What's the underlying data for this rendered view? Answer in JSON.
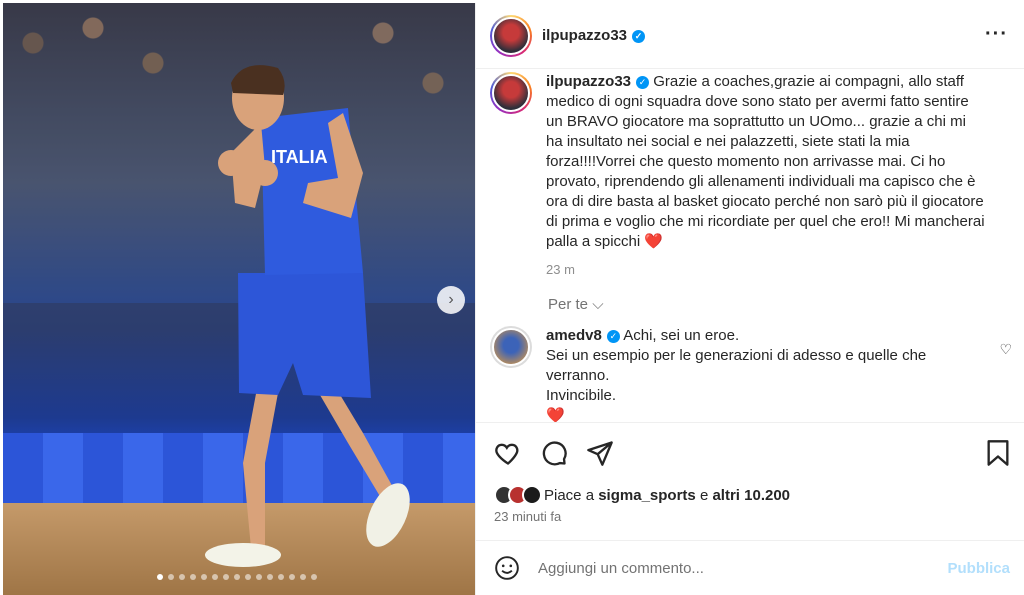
{
  "post": {
    "username": "ilpupazzo33",
    "more_icon": "more-horizontal-icon"
  },
  "caption": {
    "username": "ilpupazzo33",
    "text": "Grazie a coaches,grazie ai compagni, allo staff medico di ogni squadra dove sono stato per avermi fatto sentire un BRAVO giocatore ma soprattutto un UOmo... grazie a chi mi ha insultato nei social e nei palazzetti, siete stati la mia forza!!!!Vorrei che questo momento non arrivasse mai. Ci ho provato, riprendendo gli allenamenti individuali ma capisco che è ora di dire basta al basket giocato perché non sarò più il giocatore di prima e voglio che mi ricordiate per quel che ero!! Mi mancherai palla a spicchi",
    "heart": "❤️",
    "age": "23 m"
  },
  "per_te_label": "Per te",
  "comment": {
    "username": "amedv8",
    "line1": "Achi, sei un eroe.",
    "line2": "Sei un esempio per le generazioni di adesso e quelle che verranno.",
    "line3": "Invincibile.",
    "heart": "❤️"
  },
  "likes": {
    "prefix": "Piace a",
    "user": "sigma_sports",
    "connector": "e",
    "others": "altri 10.200"
  },
  "posted_time": "23 minuti fa",
  "add_comment": {
    "placeholder": "Aggiungi un commento...",
    "publish": "Pubblica"
  },
  "carousel": {
    "dot_count": 15,
    "active_index": 0,
    "next_symbol": "›"
  },
  "colors": {
    "accent": "#0095f6",
    "publish_disabled": "#b2dffc",
    "muted": "#737373"
  }
}
